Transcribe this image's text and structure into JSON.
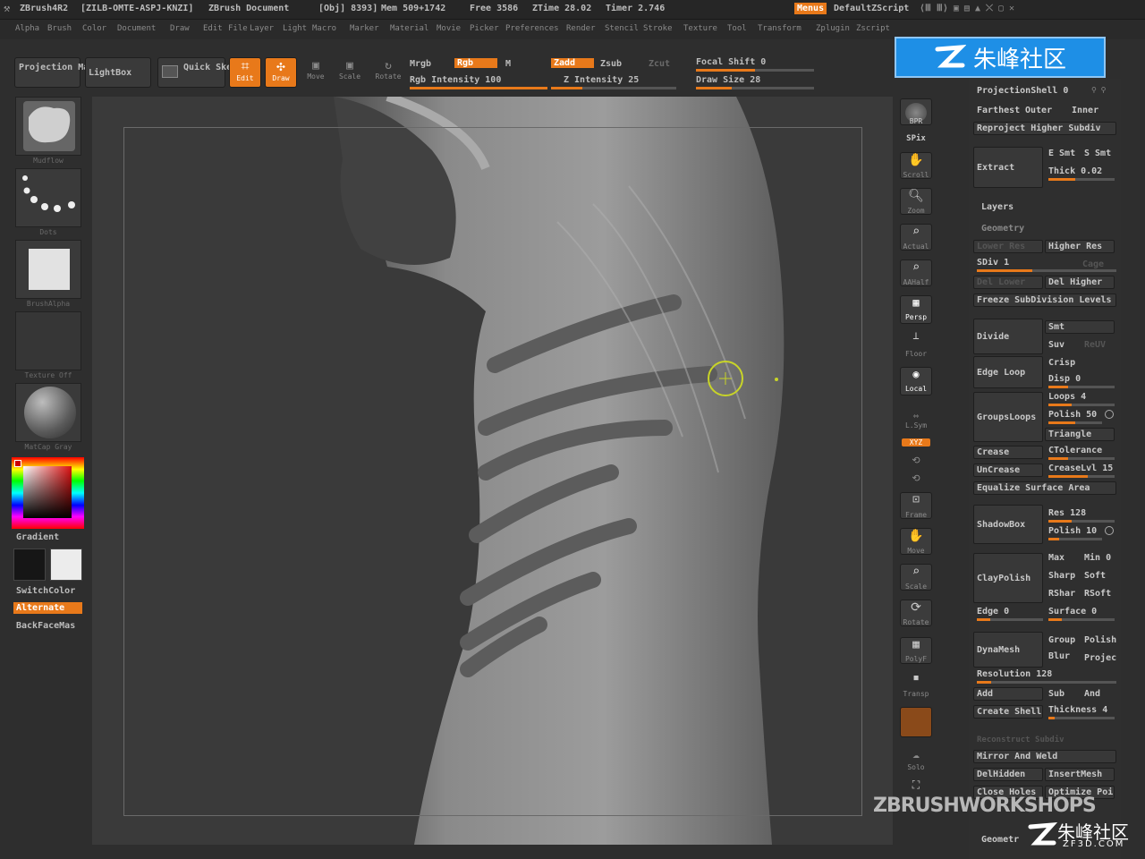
{
  "titlebar": {
    "app": "ZBrush4R2",
    "id": "[ZILB-OMTE-ASPJ-KNZI]",
    "doc": "ZBrush Document",
    "obj": "[Obj] 8393]",
    "mem": "Mem 509+1742",
    "free": "Free 3586",
    "ztime": "ZTime 28.02",
    "timer": "Timer 2.746",
    "menus": "Menus",
    "script": "DefaultZScript"
  },
  "menubar": [
    "Alpha",
    "Brush",
    "Color",
    "Document",
    "Draw",
    "Edit",
    "File",
    "Layer",
    "Light",
    "Macro",
    "Marker",
    "Material",
    "Movie",
    "Picker",
    "Preferences",
    "Render",
    "Stencil",
    "Stroke",
    "Texture",
    "Tool",
    "Transform",
    "Zplugin",
    "Zscript"
  ],
  "shelf": {
    "projection_master": "Projection Master",
    "lightbox": "LightBox",
    "quick_sketch": "Quick Sketch",
    "edit": "Edit",
    "draw": "Draw",
    "move": "Move",
    "scale": "Scale",
    "rotate": "Rotate",
    "mrgb": "Mrgb",
    "rgb": "Rgb",
    "m": "M",
    "rgb_intensity": "Rgb Intensity 100",
    "zadd": "Zadd",
    "zsub": "Zsub",
    "zcut": "Zcut",
    "z_intensity": "Z Intensity 25",
    "focal_shift": "Focal Shift 0",
    "draw_size": "Draw Size 28"
  },
  "leftshelf": {
    "brush_label": "Mudflow",
    "stroke_label": "Dots",
    "alpha_label": "BrushAlpha",
    "texture_label": "Texture Off",
    "material_label": "MatCap Gray",
    "gradient": "Gradient",
    "switchcolor": "SwitchColor",
    "alternate": "Alternate",
    "backface": "BackFaceMas"
  },
  "righttools": [
    "BPR",
    "SPix",
    "Scroll",
    "Zoom",
    "Actual",
    "AAHalf",
    "Persp",
    "Floor",
    "Local",
    "L.Sym",
    "XYZ",
    "Frame",
    "Move",
    "Scale",
    "Rotate",
    "PolyF",
    "Transp",
    "Solo"
  ],
  "palette": {
    "projectionshell": "ProjectionShell 0",
    "farthest": "Farthest",
    "outer": "Outer",
    "inner": "Inner",
    "reproject": "Reproject Higher Subdiv",
    "extract": "Extract",
    "esmt": "E Smt",
    "ssmt": "S Smt",
    "thick": "Thick 0.02",
    "layers": "Layers",
    "geometry": "Geometry",
    "lower_res": "Lower Res",
    "higher_res": "Higher Res",
    "sdiv": "SDiv 1",
    "cage": "Cage",
    "del_lower": "Del Lower",
    "del_higher": "Del Higher",
    "freeze": "Freeze SubDivision Levels",
    "divide": "Divide",
    "smt": "Smt",
    "suv": "Suv",
    "reuv": "ReUV",
    "edge_loop": "Edge Loop",
    "crisp": "Crisp",
    "disp": "Disp 0",
    "groupsloops": "GroupsLoops",
    "loops": "Loops 4",
    "polish": "Polish 50",
    "triangle": "Triangle",
    "crease": "Crease",
    "ctolerance": "CTolerance",
    "uncrease": "UnCrease",
    "creaselvl": "CreaseLvl 15",
    "equalize": "Equalize Surface Area",
    "shadowbox": "ShadowBox",
    "res128": "Res 128",
    "polish10": "Polish 10",
    "claypolish": "ClayPolish",
    "max": "Max",
    "min": "Min 0",
    "sharp": "Sharp",
    "soft": "Soft",
    "rshar": "RShar",
    "rsoft": "RSoft",
    "edge": "Edge 0",
    "surface": "Surface 0",
    "dynamesh": "DynaMesh",
    "group": "Group",
    "polish2": "Polish",
    "blur": "Blur",
    "project": "Projec",
    "resolution": "Resolution 128",
    "add": "Add",
    "sub": "Sub",
    "and": "And",
    "create_shell": "Create Shell",
    "thickness": "Thickness 4",
    "reconstruct": "Reconstruct Subdiv",
    "mirror_weld": "Mirror And Weld",
    "delhidden": "DelHidden",
    "insertmesh": "InsertMesh",
    "close_holes": "Close Holes",
    "optimize": "Optimize Poi",
    "geometry_bottom": "Geometr"
  },
  "watermarks": {
    "top_logo": "朱峰社区",
    "zbrush_workshops": "ZBRUSHWORKSHOPS",
    "bottom_logo": "朱峰社区",
    "bottom_url": "ZF3D.COM"
  },
  "colors": {
    "accent": "#e8791a",
    "bg": "#2e2e2e",
    "canvas": "#3a3a3a",
    "logo": "#1e8fe6"
  }
}
